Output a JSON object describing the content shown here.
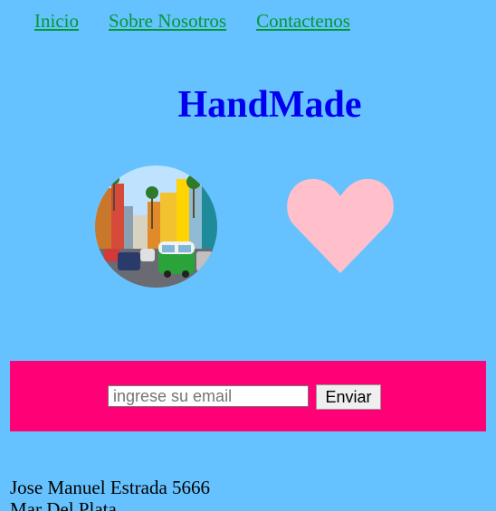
{
  "nav": {
    "items": [
      {
        "label": "Inicio"
      },
      {
        "label": "Sobre Nosotros"
      },
      {
        "label": "Contactenos"
      }
    ]
  },
  "header": {
    "title": "HandMade"
  },
  "images": {
    "photo_icon": "city-street-photo",
    "heart_icon": "heart-icon",
    "heart_color": "#ffc0cb"
  },
  "newsletter": {
    "email_placeholder": "ingrese su email",
    "email_value": "",
    "submit_label": "Enviar",
    "band_color": "#ff0077"
  },
  "footer": {
    "address_line1": "Jose Manuel Estrada 5666",
    "address_line2": "Mar Del Plata"
  },
  "colors": {
    "background": "#66c2ff",
    "nav_link": "#009933",
    "title": "#0000ee"
  }
}
